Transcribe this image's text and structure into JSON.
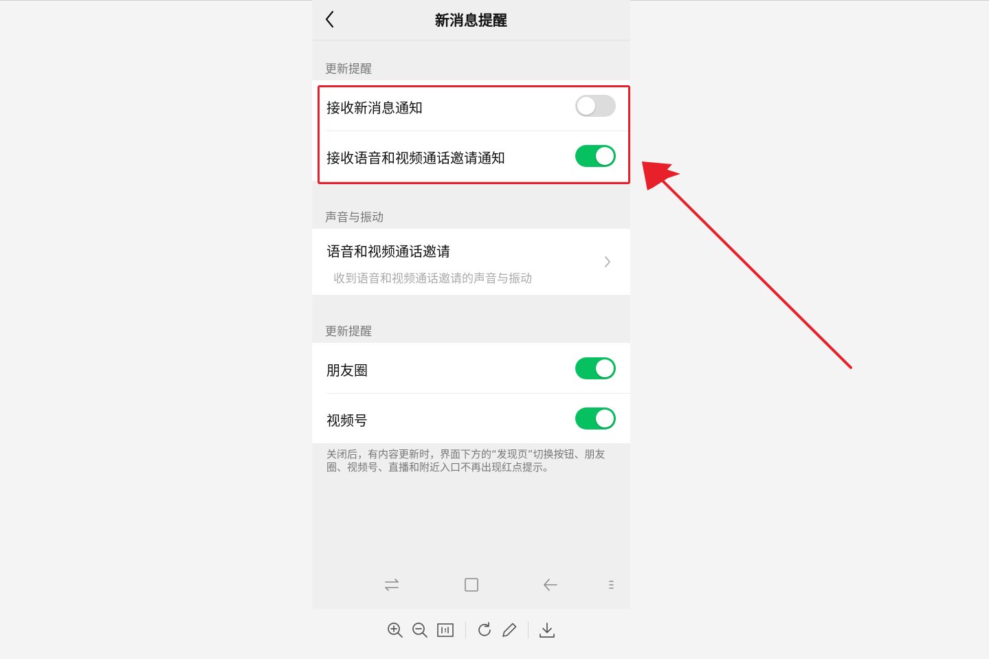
{
  "header": {
    "title": "新消息提醒"
  },
  "sections": [
    {
      "title": "更新提醒"
    },
    {
      "title": "声音与振动"
    },
    {
      "title": "更新提醒"
    }
  ],
  "notifications": {
    "new_message": {
      "label": "接收新消息通知",
      "enabled": false
    },
    "call_invite": {
      "label": "接收语音和视频通话邀请通知",
      "enabled": true
    }
  },
  "sound": {
    "call_invite": {
      "label": "语音和视频通话邀请",
      "subtitle": "收到语音和视频通话邀请的声音与振动"
    }
  },
  "updates": {
    "moments": {
      "label": "朋友圈",
      "enabled": true
    },
    "channels": {
      "label": "视频号",
      "enabled": true
    }
  },
  "footnote": "关闭后，有内容更新时，界面下方的“发现页”切换按钮、朋友圈、视频号、直播和附近入口不再出现红点提示。",
  "colors": {
    "accent": "#07c160",
    "highlight": "#e8202a",
    "toggle_off": "#dcdcdc"
  },
  "icons": {
    "back": "chevron-left-icon",
    "chevron": "chevron-right-icon",
    "system_nav": [
      "switch-apps-icon",
      "home-square-icon",
      "back-arrow-icon",
      "menu-dots-icon"
    ],
    "viewer_toolbar": [
      "zoom-in-icon",
      "zoom-out-icon",
      "actual-size-icon",
      "rotate-icon",
      "edit-pencil-icon",
      "download-icon"
    ]
  }
}
